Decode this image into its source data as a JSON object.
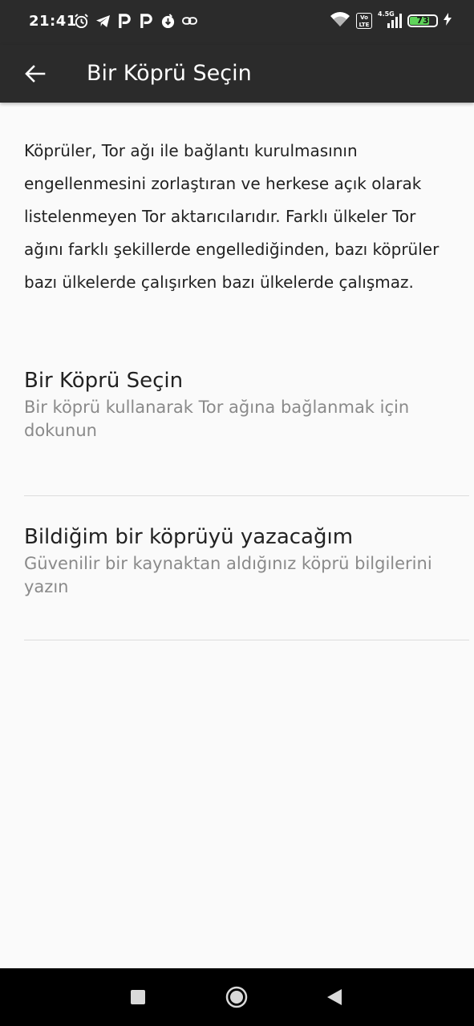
{
  "status_bar": {
    "time": "21:41",
    "notification_icons": [
      "alarm-icon",
      "telegram-icon",
      "p-app-icon",
      "p-app-icon",
      "tor-app-icon",
      "link-icon"
    ],
    "network_type": "4.5G",
    "volte_label": "Vo LTE",
    "battery_level": "73",
    "charging": true
  },
  "app_bar": {
    "title": "Bir Köprü Seçin",
    "back_icon": "arrow-left-icon"
  },
  "intro_text": "Köprüler, Tor ağı ile bağlantı kurulmasının engellenmesini zorlaştıran ve herkese açık olarak listelenmeyen Tor aktarıcılarıdır. Farklı ülkeler Tor ağını farklı şekillerde engellediğinden, bazı köprüler bazı ülkelerde çalışırken bazı ülkelerde çalışmaz.",
  "options": [
    {
      "title": "Bir Köprü Seçin",
      "subtitle": "Bir köprü kullanarak Tor ağına bağlanmak için dokunun"
    },
    {
      "title": "Bildiğim bir köprüyü yazacağım",
      "subtitle": "Güvenilir bir kaynaktan aldığınız köprü bilgilerini yazın"
    }
  ],
  "nav_bar": {
    "buttons": [
      "recents-square-icon",
      "home-circle-icon",
      "back-triangle-icon"
    ]
  },
  "colors": {
    "bar_background": "#2b2b2b",
    "page_background": "#fafafa",
    "primary_text": "#222222",
    "secondary_text": "#8a8a8a",
    "battery_fill": "#5fd35a"
  }
}
